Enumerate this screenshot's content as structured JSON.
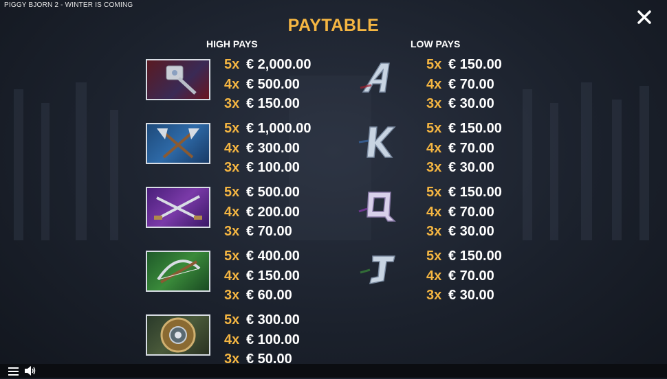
{
  "game_title": "PIGGY BJORN 2 - WINTER IS COMING",
  "heading": "PAYTABLE",
  "high_heading": "HIGH PAYS",
  "low_heading": "LOW PAYS",
  "icons": {
    "close": "close-icon",
    "menu": "menu-icon",
    "sound": "speaker-icon"
  },
  "colors": {
    "accent": "#f5b642",
    "text": "#ffffff",
    "background": "#1b212c"
  },
  "high_pays": [
    {
      "symbol": "hammer",
      "pays": [
        {
          "mult": "5x",
          "amount": "€ 2,000.00"
        },
        {
          "mult": "4x",
          "amount": "€ 500.00"
        },
        {
          "mult": "3x",
          "amount": "€ 150.00"
        }
      ]
    },
    {
      "symbol": "crossed-axes",
      "pays": [
        {
          "mult": "5x",
          "amount": "€ 1,000.00"
        },
        {
          "mult": "4x",
          "amount": "€ 300.00"
        },
        {
          "mult": "3x",
          "amount": "€ 100.00"
        }
      ]
    },
    {
      "symbol": "crossed-swords",
      "pays": [
        {
          "mult": "5x",
          "amount": "€ 500.00"
        },
        {
          "mult": "4x",
          "amount": "€ 200.00"
        },
        {
          "mult": "3x",
          "amount": "€ 70.00"
        }
      ]
    },
    {
      "symbol": "crossbow",
      "pays": [
        {
          "mult": "5x",
          "amount": "€ 400.00"
        },
        {
          "mult": "4x",
          "amount": "€ 150.00"
        },
        {
          "mult": "3x",
          "amount": "€ 60.00"
        }
      ]
    },
    {
      "symbol": "shield",
      "pays": [
        {
          "mult": "5x",
          "amount": "€ 300.00"
        },
        {
          "mult": "4x",
          "amount": "€ 100.00"
        },
        {
          "mult": "3x",
          "amount": "€ 50.00"
        }
      ]
    }
  ],
  "low_pays": [
    {
      "symbol": "A",
      "pays": [
        {
          "mult": "5x",
          "amount": "€ 150.00"
        },
        {
          "mult": "4x",
          "amount": "€ 70.00"
        },
        {
          "mult": "3x",
          "amount": "€ 30.00"
        }
      ]
    },
    {
      "symbol": "K",
      "pays": [
        {
          "mult": "5x",
          "amount": "€ 150.00"
        },
        {
          "mult": "4x",
          "amount": "€ 70.00"
        },
        {
          "mult": "3x",
          "amount": "€ 30.00"
        }
      ]
    },
    {
      "symbol": "Q",
      "pays": [
        {
          "mult": "5x",
          "amount": "€ 150.00"
        },
        {
          "mult": "4x",
          "amount": "€ 70.00"
        },
        {
          "mult": "3x",
          "amount": "€ 30.00"
        }
      ]
    },
    {
      "symbol": "J",
      "pays": [
        {
          "mult": "5x",
          "amount": "€ 150.00"
        },
        {
          "mult": "4x",
          "amount": "€ 70.00"
        },
        {
          "mult": "3x",
          "amount": "€ 30.00"
        }
      ]
    }
  ]
}
